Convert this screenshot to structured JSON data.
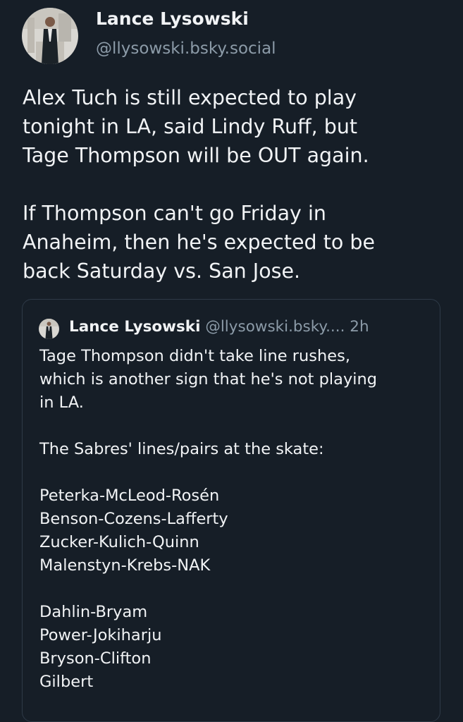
{
  "author": {
    "name": "Lance Lysowski",
    "handle": "@llysowski.bsky.social"
  },
  "post": {
    "para1": [
      "Alex Tuch is still expected to play",
      "tonight in LA, said Lindy Ruff, but",
      "Tage Thompson will be OUT again."
    ],
    "para2": [
      "If Thompson can't go Friday in",
      "Anaheim, then he's expected to be",
      "back Saturday vs. San Jose."
    ]
  },
  "quote": {
    "name": "Lance Lysowski",
    "handle": "@llysowski.bsky....",
    "time": "2h",
    "intro": [
      "Tage Thompson didn't take line rushes,",
      "which is another sign that he's not playing",
      "in LA."
    ],
    "lines_heading": "The Sabres' lines/pairs at the skate:",
    "forward_lines": [
      "Peterka-McLeod-Rosén",
      "Benson-Cozens-Lafferty",
      "Zucker-Kulich-Quinn",
      "Malenstyn-Krebs-NAK"
    ],
    "defense_pairs": [
      "Dahlin-Bryam",
      "Power-Jokiharju",
      "Bryson-Clifton",
      "Gilbert"
    ]
  },
  "colors": {
    "background": "#161e27",
    "text": "#f1f3f5",
    "muted": "#8c9ba8",
    "border": "#2e3a47"
  }
}
